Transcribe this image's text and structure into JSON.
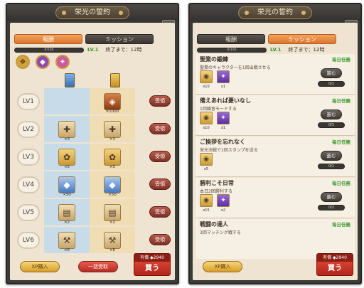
{
  "left": {
    "title": "栄光の誓約",
    "tabs": {
      "reward": "報酬",
      "mission": "ミッション"
    },
    "progress": {
      "text": "0/100",
      "fraction": 0.0
    },
    "level": "LV.1",
    "remaining": "終了まで：12時",
    "rows": [
      {
        "lv": "LV1",
        "free_qty": "",
        "paid_qty": "×1000",
        "free_icon": "",
        "paid_icon": "gem-coin-icon"
      },
      {
        "lv": "LV2",
        "free_qty": "×3",
        "paid_qty": "×3",
        "free_icon": "book-icon",
        "paid_icon": "book-icon"
      },
      {
        "lv": "LV3",
        "free_qty": "×5",
        "paid_qty": "×5",
        "free_icon": "scroll-icon",
        "paid_icon": "scroll-icon"
      },
      {
        "lv": "LV4",
        "free_qty": "×50",
        "paid_qty": "×50",
        "free_icon": "gem-chest-icon",
        "paid_icon": "gem-chest-icon"
      },
      {
        "lv": "LV5",
        "free_qty": "×2",
        "paid_qty": "×2",
        "free_icon": "map-icon",
        "paid_icon": "map-icon"
      },
      {
        "lv": "LV6",
        "free_qty": "×6",
        "paid_qty": "×6",
        "free_icon": "pickaxe-icon",
        "paid_icon": "pickaxe-icon"
      }
    ],
    "claim_label": "受領",
    "xp_button": "XP購入",
    "bulk_button": "一括受取",
    "buy": {
      "price_prefix": "有償",
      "price": "2940",
      "label": "買う"
    }
  },
  "right": {
    "title": "栄光の誓約",
    "tabs": {
      "reward": "報酬",
      "mission": "ミッション"
    },
    "progress": {
      "text": "0/100",
      "fraction": 0.0
    },
    "level": "LV.1",
    "remaining": "終了まで：12時",
    "missions": [
      {
        "title": "聖業の鍛錬",
        "tag": "毎日任務",
        "desc": "聖業のキャラクターを1回出戦させる",
        "rewards": [
          {
            "qty": "x10"
          },
          {
            "qty": "x1"
          }
        ],
        "go": "進む",
        "progress": "0/1",
        "fraction": 0.0
      },
      {
        "title": "備えあれば憂いなし",
        "tag": "毎日任務",
        "desc": "1回練習モードする",
        "rewards": [
          {
            "qty": "x10"
          },
          {
            "qty": "x1"
          }
        ],
        "go": "進む",
        "progress": "0/1",
        "fraction": 0.0
      },
      {
        "title": "ご挨拶を忘れなく",
        "tag": "毎日任務",
        "desc": "栄光決戦で1回スタンプを送る",
        "rewards": [
          {
            "qty": "x5"
          }
        ],
        "go": "進む",
        "progress": "0/1",
        "fraction": 0.0
      },
      {
        "title": "勝利こそ日常",
        "tag": "毎日任務",
        "desc": "本日2回勝利する",
        "rewards": [
          {
            "qty": "x15"
          },
          {
            "qty": "x2"
          }
        ],
        "go": "進む",
        "progress": "0/2",
        "fraction": 0.0
      },
      {
        "title": "戦闘の達人",
        "tag": "毎日任務",
        "desc": "3回マッチング戦する",
        "rewards": [],
        "go": "",
        "progress": "",
        "fraction": 0.0
      }
    ],
    "xp_button": "XP購入",
    "buy": {
      "price_prefix": "有償",
      "price": "2940",
      "label": "買う"
    }
  },
  "colors": {
    "accent_orange": "#d9762d",
    "daily_green": "#3d9a2a",
    "claim_red": "#7e3024"
  }
}
